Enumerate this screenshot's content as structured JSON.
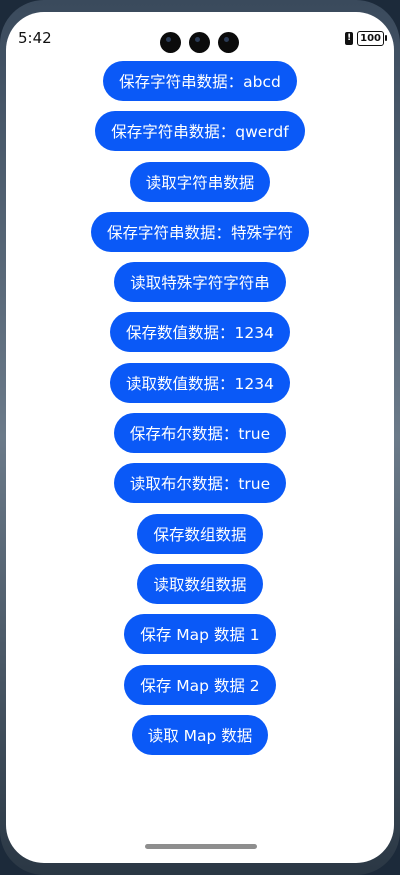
{
  "status_bar": {
    "time": "5:42",
    "battery": "100"
  },
  "buttons": [
    {
      "label": "保存字符串数据：abcd"
    },
    {
      "label": "保存字符串数据：qwerdf"
    },
    {
      "label": "读取字符串数据"
    },
    {
      "label": "保存字符串数据：特殊字符"
    },
    {
      "label": "读取特殊字符字符串"
    },
    {
      "label": "保存数值数据：1234"
    },
    {
      "label": "读取数值数据：1234"
    },
    {
      "label": "保存布尔数据：true"
    },
    {
      "label": "读取布尔数据：true"
    },
    {
      "label": "保存数组数据"
    },
    {
      "label": "读取数组数据"
    },
    {
      "label": "保存 Map 数据 1"
    },
    {
      "label": "保存 Map 数据 2"
    },
    {
      "label": "读取 Map 数据"
    }
  ],
  "colors": {
    "button_bg": "#0a59f7",
    "button_text": "#ffffff",
    "screen_bg": "#ffffff"
  }
}
